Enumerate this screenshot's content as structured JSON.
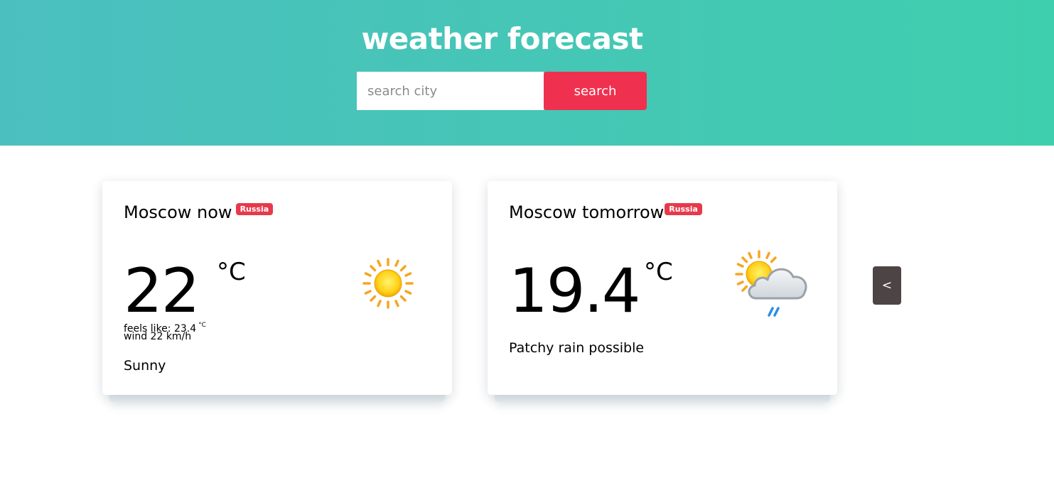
{
  "header": {
    "title": "weather forecast",
    "search_placeholder": "search city",
    "search_value": "",
    "search_button": "search",
    "colors": {
      "gradient_start": "#4bbfc0",
      "gradient_end": "#3ecfae",
      "button": "#f0304f"
    }
  },
  "cards": [
    {
      "title": "Moscow now",
      "badge": "Russia",
      "temperature": "22",
      "unit": "°C",
      "feels_like_label": "feels like: 23.4",
      "feels_like_unit": "°C",
      "wind": "wind 22 km/h",
      "condition": "Sunny",
      "icon": "sun-icon"
    },
    {
      "title": "Moscow tomorrow",
      "badge": "Russia",
      "temperature": "19.4",
      "unit": "°C",
      "condition": "Patchy rain possible",
      "icon": "sun-cloud-rain-icon"
    }
  ],
  "nav": {
    "prev_label": "<"
  }
}
